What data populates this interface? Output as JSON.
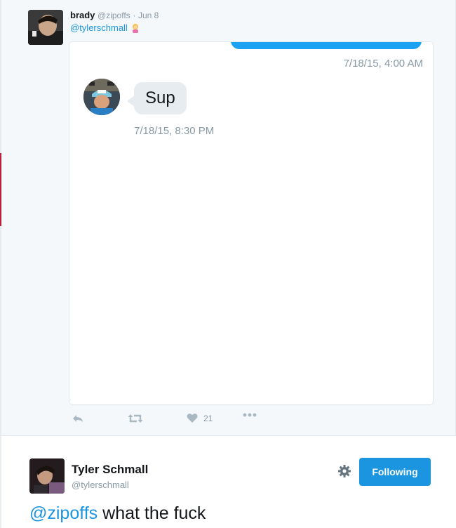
{
  "quoted_tweet": {
    "author_name": "brady",
    "author_handle": "@zipoffs",
    "separator": "·",
    "date": "Jun 8",
    "mention": "@tylerschmall",
    "emoji_icon": "woman-tipping-hand-emoji"
  },
  "dm_screenshot": {
    "timestamp_top": "7/18/15, 4:00 AM",
    "message": "Sup",
    "timestamp_bottom": "7/18/15, 8:30 PM"
  },
  "actions": {
    "reply_icon": "reply-icon",
    "retweet_icon": "retweet-icon",
    "like_icon": "heart-icon",
    "like_count": "21",
    "more_icon": "more-icon"
  },
  "main_tweet": {
    "author_name": "Tyler Schmall",
    "author_handle": "@tylerschmall",
    "follow_label": "Following",
    "mention": "@zipoffs",
    "text": " what the fuck"
  },
  "colors": {
    "accent": "#1b95e0",
    "muted": "#8899a6",
    "bubble": "#e6ecf0"
  }
}
